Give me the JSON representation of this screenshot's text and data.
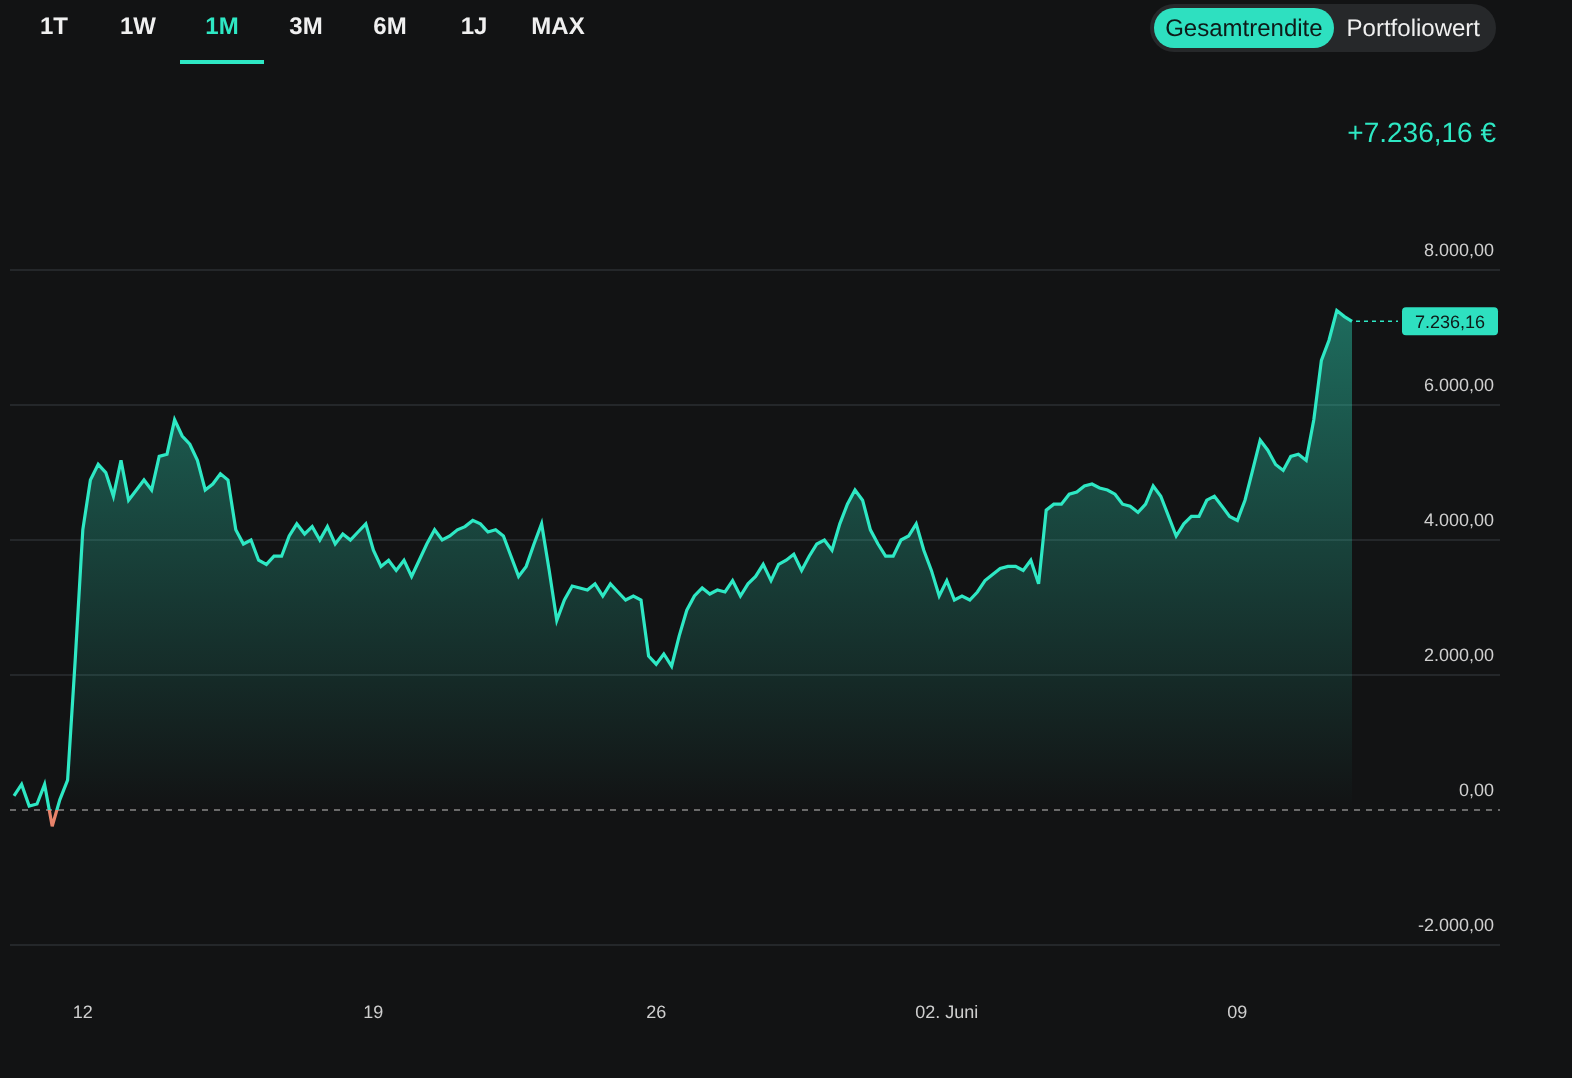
{
  "range_tabs": [
    {
      "label": "1T",
      "selected": false
    },
    {
      "label": "1W",
      "selected": false
    },
    {
      "label": "1M",
      "selected": true
    },
    {
      "label": "3M",
      "selected": false
    },
    {
      "label": "6M",
      "selected": false
    },
    {
      "label": "1J",
      "selected": false
    },
    {
      "label": "MAX",
      "selected": false
    }
  ],
  "view_toggle": [
    {
      "label": "Gesamtrendite",
      "selected": true
    },
    {
      "label": "Portfoliowert",
      "selected": false
    }
  ],
  "total_return": "+7.236,16 €",
  "chart": {
    "current_value_label": "7.236,16",
    "chart_data": {
      "type": "area",
      "grid": true,
      "ylim": [
        -2000,
        8000
      ],
      "categories": [
        null,
        null,
        null,
        null,
        null,
        null,
        null,
        null,
        null,
        "12",
        null,
        null,
        null,
        null,
        null,
        null,
        null,
        null,
        null,
        null,
        null,
        null,
        null,
        null,
        null,
        null,
        null,
        null,
        null,
        null,
        null,
        null,
        null,
        null,
        null,
        null,
        null,
        null,
        null,
        null,
        null,
        null,
        null,
        null,
        null,
        null,
        null,
        "19",
        null,
        null,
        null,
        null,
        null,
        null,
        null,
        null,
        null,
        null,
        null,
        null,
        null,
        null,
        null,
        null,
        null,
        null,
        null,
        null,
        null,
        null,
        null,
        null,
        null,
        null,
        null,
        null,
        null,
        null,
        null,
        null,
        null,
        null,
        null,
        null,
        "26",
        null,
        null,
        null,
        null,
        null,
        null,
        null,
        null,
        null,
        null,
        null,
        null,
        null,
        null,
        null,
        null,
        null,
        null,
        null,
        null,
        null,
        null,
        null,
        null,
        null,
        null,
        null,
        null,
        null,
        null,
        null,
        null,
        null,
        null,
        null,
        null,
        null,
        "02. Juni",
        null,
        null,
        null,
        null,
        null,
        null,
        null,
        null,
        null,
        null,
        null,
        null,
        null,
        null,
        null,
        null,
        null,
        null,
        null,
        null,
        null,
        null,
        null,
        null,
        null,
        null,
        null,
        null,
        null,
        null,
        null,
        null,
        null,
        null,
        null,
        null,
        null,
        "09",
        null,
        null,
        null,
        null,
        null,
        null,
        null,
        null,
        null,
        null,
        null,
        null,
        null,
        null,
        null
      ],
      "ref_lines": [
        {
          "axis": "y",
          "value": 0
        }
      ],
      "yticks": [
        {
          "value": 8000,
          "label": "8.000,00"
        },
        {
          "value": 6000,
          "label": "6.000,00"
        },
        {
          "value": 4000,
          "label": "4.000,00"
        },
        {
          "value": 2000,
          "label": "2.000,00"
        },
        {
          "value": 0,
          "label": "0,00"
        },
        {
          "value": -2000,
          "label": "-2.000,00"
        }
      ],
      "series": [
        {
          "color": "#2ee8c4",
          "values": [
            210,
            380,
            60,
            90,
            380,
            -240,
            150,
            440,
            2220,
            4150,
            4890,
            5120,
            5000,
            4650,
            5180,
            4590,
            4740,
            4890,
            4740,
            5240,
            5270,
            5780,
            5540,
            5420,
            5180,
            4740,
            4830,
            4980,
            4890,
            4150,
            3940,
            4000,
            3700,
            3640,
            3760,
            3760,
            4060,
            4240,
            4090,
            4200,
            4000,
            4200,
            3940,
            4090,
            4000,
            4120,
            4240,
            3850,
            3610,
            3700,
            3550,
            3700,
            3460,
            3700,
            3940,
            4150,
            4000,
            4060,
            4150,
            4200,
            4290,
            4240,
            4120,
            4150,
            4060,
            3760,
            3460,
            3610,
            3940,
            4240,
            3550,
            2810,
            3110,
            3320,
            3290,
            3260,
            3350,
            3170,
            3350,
            3230,
            3110,
            3170,
            3110,
            2280,
            2160,
            2310,
            2130,
            2580,
            2960,
            3170,
            3290,
            3200,
            3260,
            3230,
            3400,
            3170,
            3350,
            3460,
            3640,
            3400,
            3640,
            3700,
            3790,
            3550,
            3760,
            3940,
            4000,
            3850,
            4240,
            4530,
            4740,
            4590,
            4150,
            3940,
            3760,
            3760,
            4000,
            4060,
            4240,
            3850,
            3550,
            3170,
            3400,
            3110,
            3170,
            3110,
            3230,
            3400,
            3490,
            3580,
            3610,
            3610,
            3550,
            3700,
            3350,
            4440,
            4530,
            4530,
            4680,
            4710,
            4800,
            4830,
            4770,
            4740,
            4680,
            4530,
            4500,
            4410,
            4530,
            4800,
            4650,
            4350,
            4060,
            4240,
            4350,
            4350,
            4590,
            4650,
            4500,
            4350,
            4290,
            4590,
            5030,
            5480,
            5330,
            5120,
            5030,
            5240,
            5270,
            5180,
            5780,
            6660,
            6960,
            7400,
            7310,
            7240
          ]
        }
      ]
    }
  }
}
